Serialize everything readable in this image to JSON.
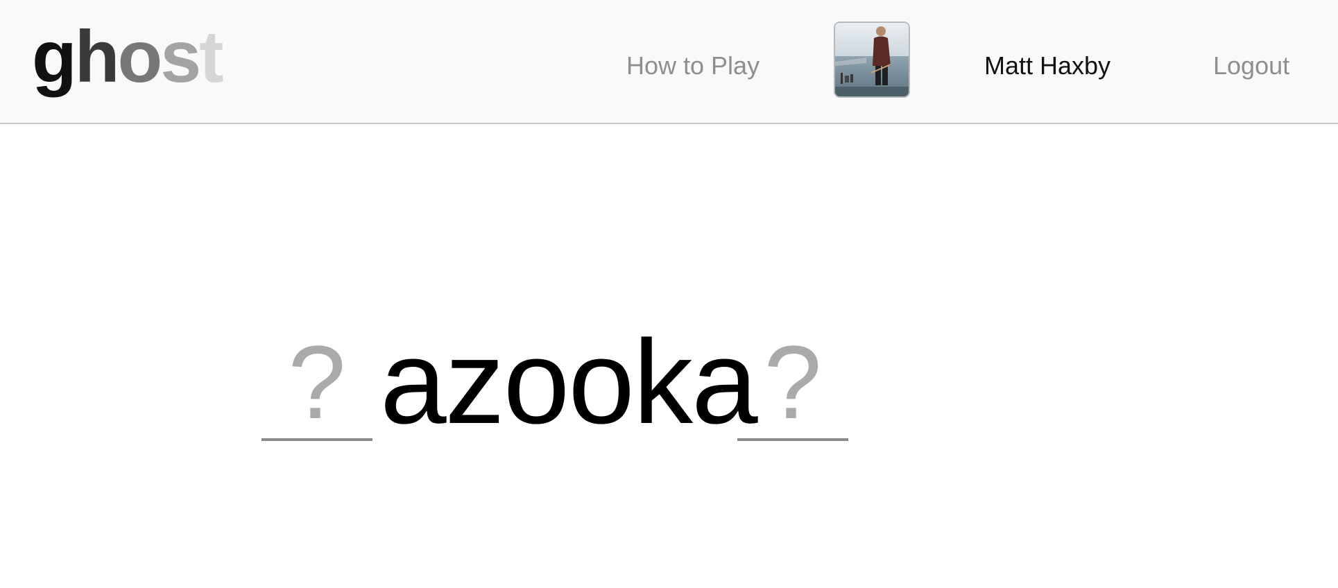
{
  "header": {
    "logo_letters": [
      {
        "char": "g",
        "color": "#111111"
      },
      {
        "char": "h",
        "color": "#3a3a3a"
      },
      {
        "char": "o",
        "color": "#777777"
      },
      {
        "char": "s",
        "color": "#a3a3a3"
      },
      {
        "char": "t",
        "color": "#d6d6d6"
      }
    ],
    "nav": {
      "how_to_play": "How to Play",
      "user_name": "Matt Haxby",
      "logout": "Logout"
    },
    "avatar_icon": "user-photo"
  },
  "game": {
    "word": "azooka",
    "left_slot": "?",
    "right_slot": "?"
  }
}
